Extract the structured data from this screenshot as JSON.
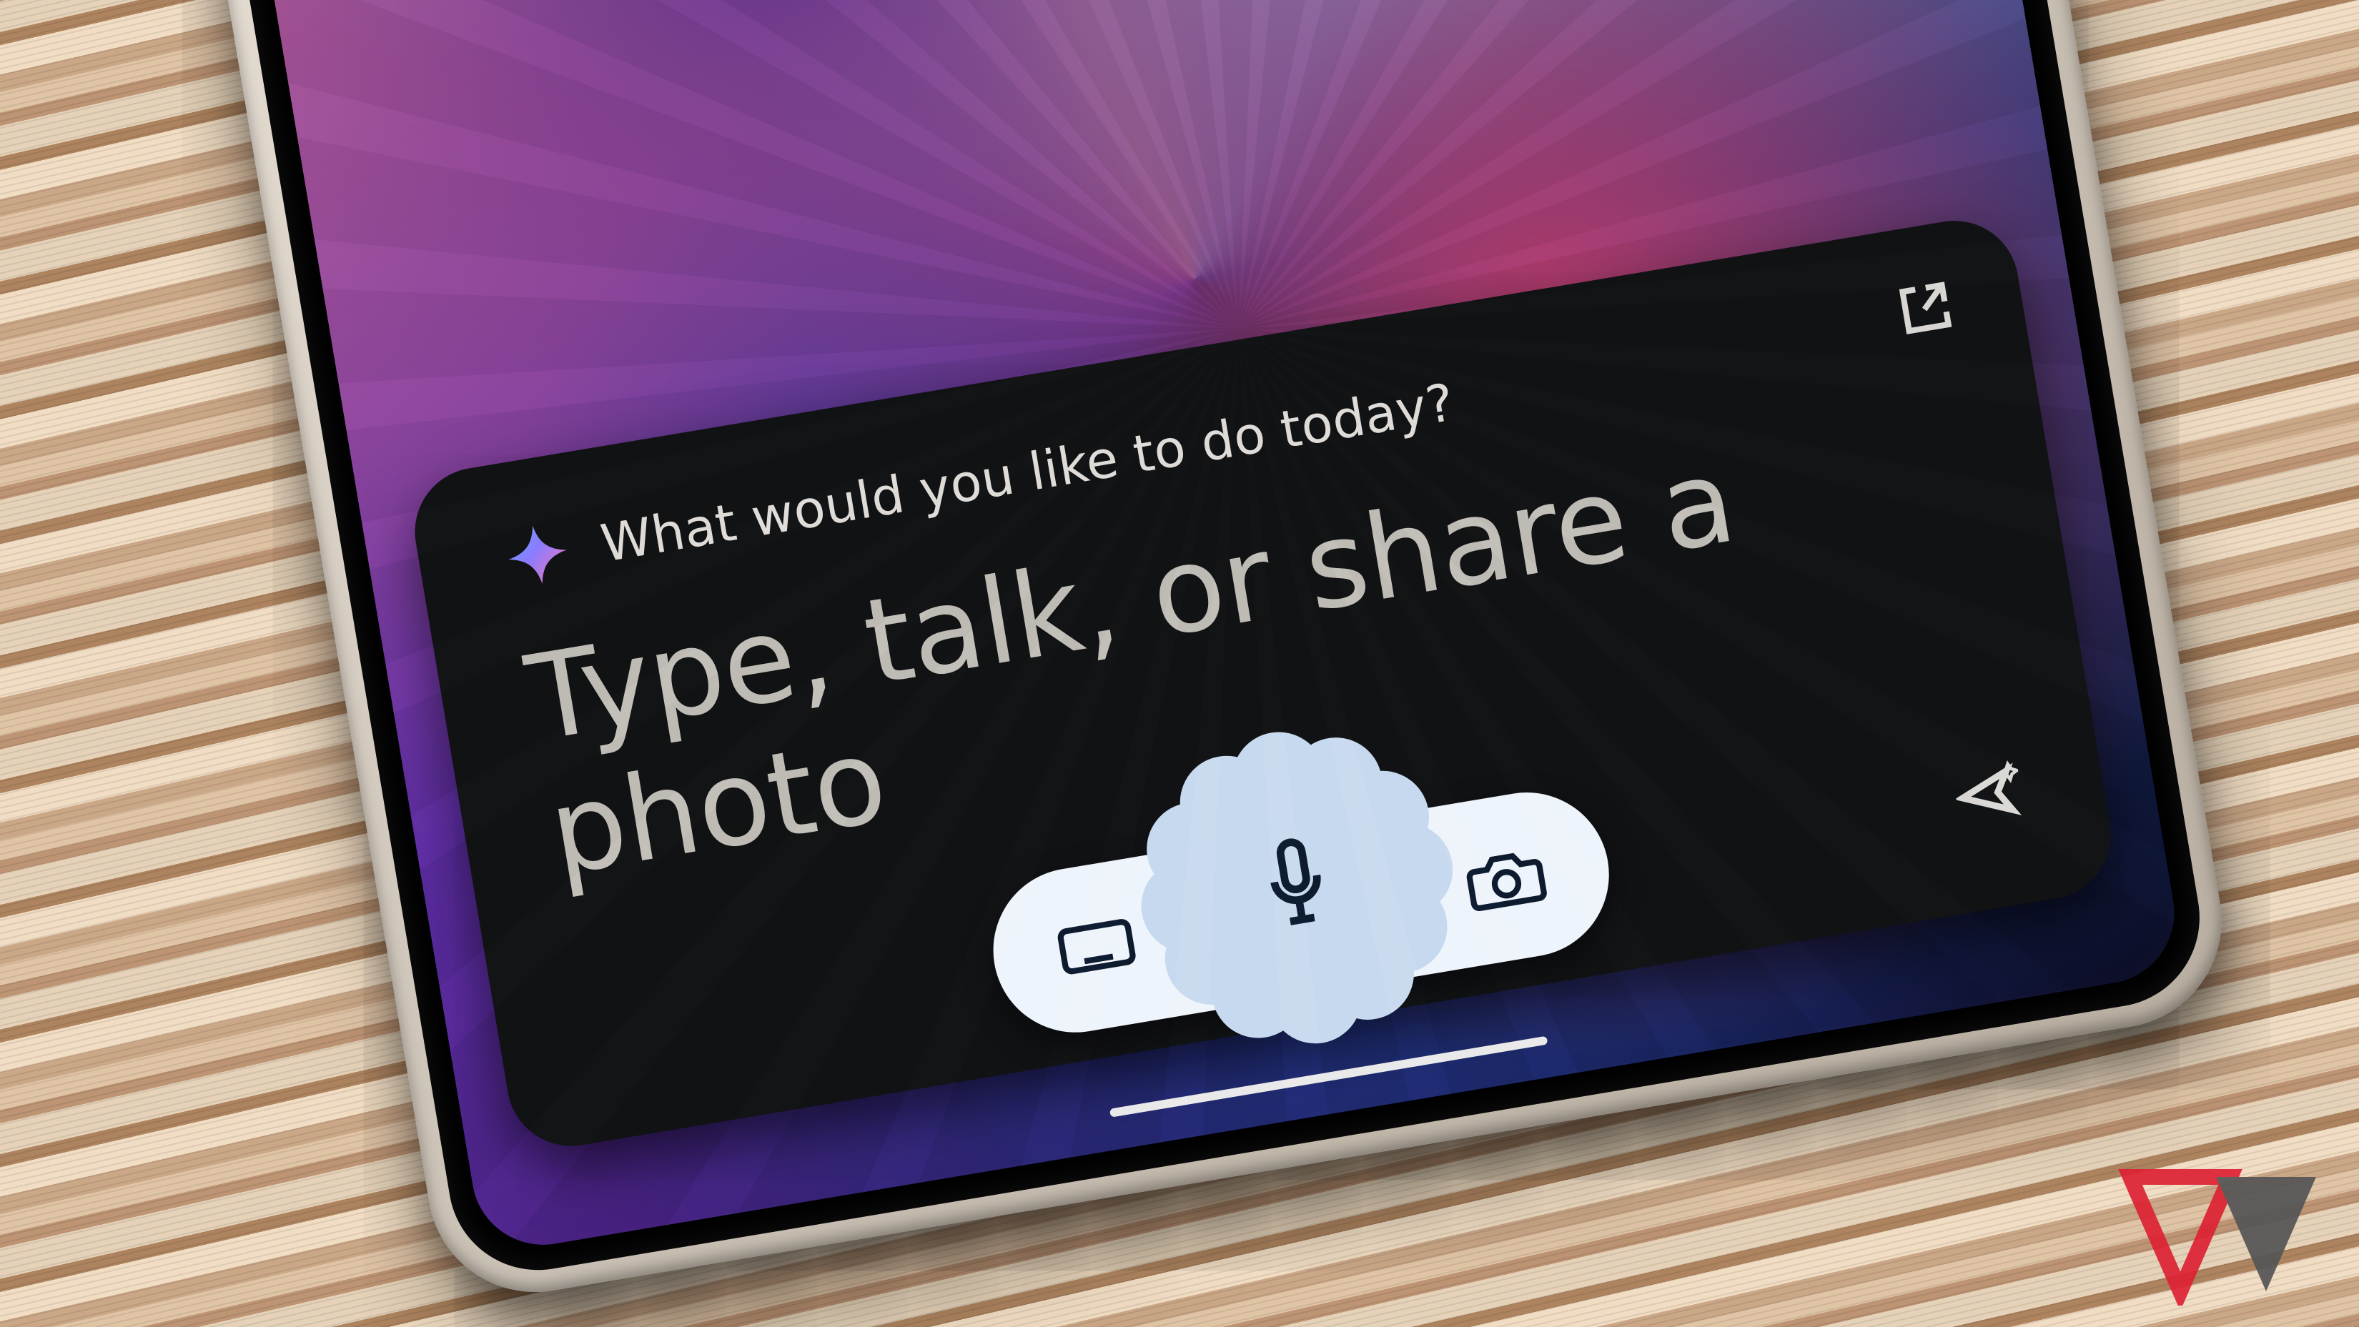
{
  "assistant_card": {
    "prompt": "What would you like to do today?",
    "placeholder": "Type, talk, or share a photo"
  },
  "icons": {
    "spark": "gemini-spark-icon",
    "expand": "open-in-new-icon",
    "send": "send-sparkle-icon",
    "keyboard": "keyboard-icon",
    "mic": "microphone-icon",
    "camera": "camera-icon"
  },
  "colors": {
    "card_bg": "#111214",
    "text_primary": "#d8d6d3",
    "text_muted": "#bebab4",
    "pill_bg": "#eef4fb",
    "mic_badge": "#c6d9ef",
    "icon_dark": "#0e1b2e"
  }
}
